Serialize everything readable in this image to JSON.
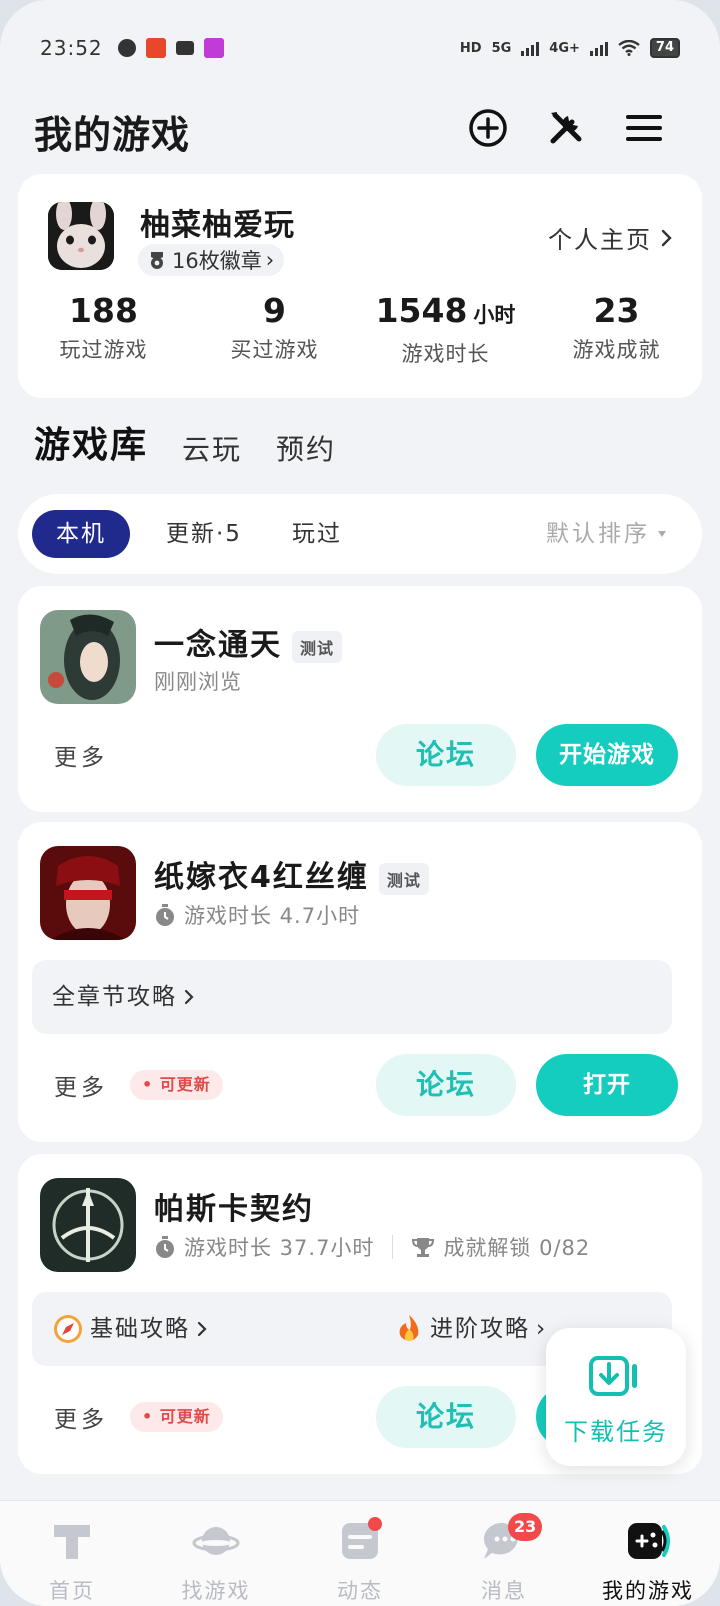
{
  "status_bar": {
    "time": "23:52",
    "network_hd": "HD",
    "network_5g": "5G",
    "network_4g": "4G+",
    "battery": "74"
  },
  "header": {
    "title": "我的游戏"
  },
  "profile": {
    "name": "柚菜柚爱玩",
    "badges": "16枚徽章",
    "home_link": "个人主页",
    "stats": [
      {
        "value": "188",
        "unit": "",
        "label": "玩过游戏"
      },
      {
        "value": "9",
        "unit": "",
        "label": "买过游戏"
      },
      {
        "value": "1548",
        "unit": "小时",
        "label": "游戏时长"
      },
      {
        "value": "23",
        "unit": "",
        "label": "游戏成就"
      }
    ]
  },
  "library_tabs": [
    "游戏库",
    "云玩",
    "预约"
  ],
  "filters": {
    "chips": [
      "本机",
      "更新·5",
      "玩过"
    ],
    "sort": "默认排序"
  },
  "games": [
    {
      "name": "一念通天",
      "tag": "测试",
      "subtitle": "刚刚浏览",
      "more": "更多",
      "forum": "论坛",
      "primary": "开始游戏"
    },
    {
      "name": "纸嫁衣4红丝缠",
      "tag": "测试",
      "playtime": "游戏时长 4.7小时",
      "guide": "全章节攻略",
      "more": "更多",
      "update": "可更新",
      "forum": "论坛",
      "primary": "打开"
    },
    {
      "name": "帕斯卡契约",
      "playtime": "游戏时长 37.7小时",
      "achievement": "成就解锁 0/82",
      "guide_basic": "基础攻略",
      "guide_advanced": "进阶攻略",
      "more": "更多",
      "update": "可更新",
      "forum": "论坛"
    }
  ],
  "download_task": "下载任务",
  "bottom_nav": [
    {
      "label": "首页"
    },
    {
      "label": "找游戏"
    },
    {
      "label": "动态"
    },
    {
      "label": "消息",
      "badge": "23"
    },
    {
      "label": "我的游戏"
    }
  ],
  "colors": {
    "accent": "#14cdbf",
    "chip_active": "#1f2a8c",
    "badge_red": "#f24a4a"
  }
}
